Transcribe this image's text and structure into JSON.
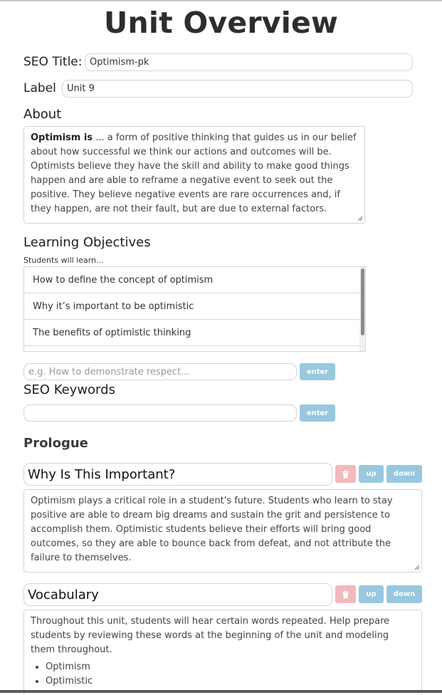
{
  "page": {
    "title": "Unit Overview"
  },
  "seo_title": {
    "label": "SEO Title:",
    "value": "Optimism-pk"
  },
  "label_field": {
    "label": "Label",
    "value": "Unit 9"
  },
  "about": {
    "heading": "About",
    "bold_lead": "Optimism is",
    "text": " ... a form of positive thinking that guides us in our belief about how successful we think our actions and outcomes will be. Optimists believe they have the skill and ability to make good things happen and are able to reframe a negative event to seek out the positive. They believe negative events are rare occurrences and, if they happen, are not their fault, but are due to external factors."
  },
  "objectives": {
    "heading": "Learning Objectives",
    "subheading": "Students will learn...",
    "items": [
      "How to define the concept of optimism",
      "Why it’s important to be optimistic",
      "The benefits of optimistic thinking",
      ""
    ],
    "input_placeholder": "e.g. How to demonstrate respect...",
    "enter_label": "enter"
  },
  "keywords": {
    "heading": "SEO Keywords",
    "input_value": "",
    "enter_label": "enter"
  },
  "prologue": {
    "heading": "Prologue",
    "sections": [
      {
        "title": "Why Is This Important?",
        "body": "Optimism plays a critical role in a student's future. Students who learn to stay positive are able to dream big dreams and sustain the grit and persistence to accomplish them. Optimistic students believe their efforts will bring good outcomes, so they are able to bounce back from defeat, and not attribute the failure to themselves.",
        "up_label": "up",
        "down_label": "down"
      },
      {
        "title": "Vocabulary",
        "body": "Throughout this unit, students will hear certain words repeated. Help prepare students by reviewing these words at the beginning of the unit and modeling them throughout.",
        "bullets": [
          "Optimism",
          "Optimistic"
        ],
        "up_label": "up",
        "down_label": "down"
      }
    ]
  },
  "icons": {
    "delete": "trash-icon",
    "resize": "resize-grip-icon"
  },
  "colors": {
    "button_blue": "#98c8df",
    "button_pink": "#f3b9bd",
    "border": "#cfd8d4"
  }
}
